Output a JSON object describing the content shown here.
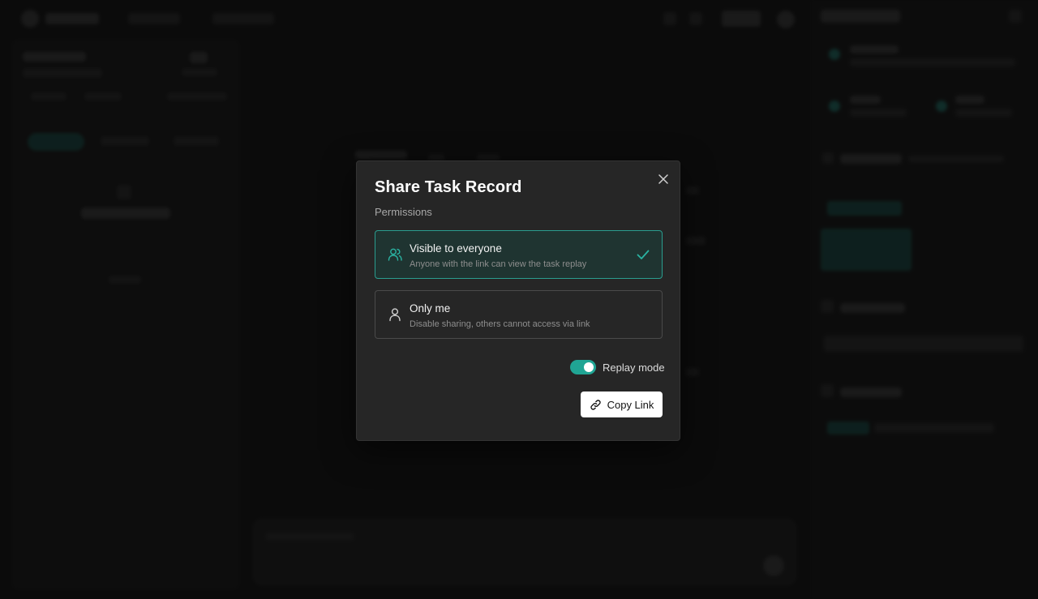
{
  "modal": {
    "title": "Share Task Record",
    "section_label": "Permissions",
    "options": [
      {
        "title": "Visible to everyone",
        "description": "Anyone with the link can view the task replay",
        "icon": "users-icon",
        "selected": true
      },
      {
        "title": "Only me",
        "description": "Disable sharing, others cannot access via link",
        "icon": "user-icon",
        "selected": false
      }
    ],
    "replay_mode": {
      "label": "Replay mode",
      "enabled": true
    },
    "copy_button_label": "Copy Link"
  },
  "colors": {
    "accent": "#20a594",
    "selected_border": "#2a9d8f",
    "modal_bg": "#262626",
    "page_bg": "#121212"
  }
}
